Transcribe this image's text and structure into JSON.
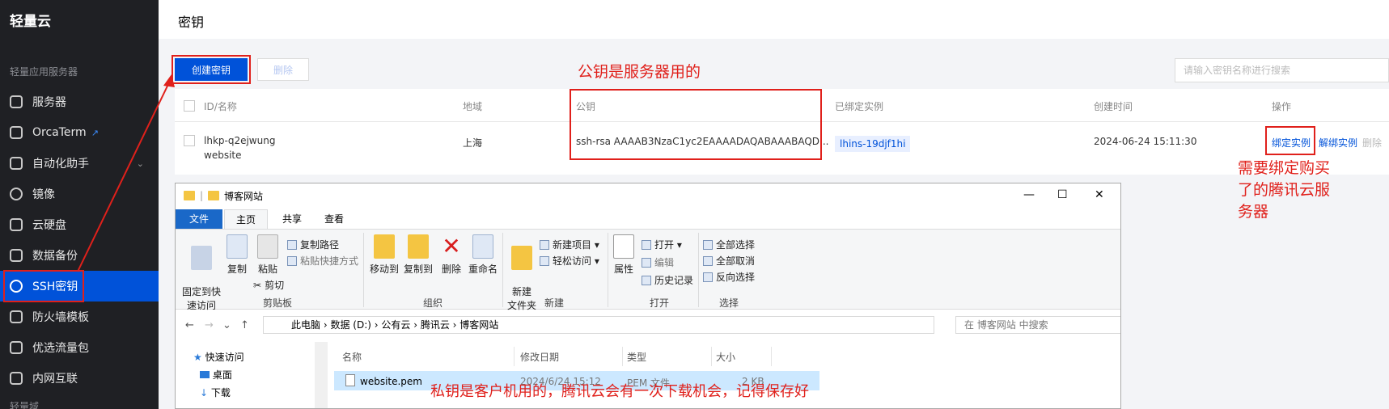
{
  "sidebar": {
    "title": "轻量云",
    "section": "轻量应用服务器",
    "items": [
      {
        "label": "服务器",
        "icon": "box-icon"
      },
      {
        "label": "OrcaTerm",
        "icon": "terminal-icon",
        "ext": "↗"
      },
      {
        "label": "自动化助手",
        "icon": "robot-icon",
        "chevron": "⌄"
      },
      {
        "label": "镜像",
        "icon": "disc-icon"
      },
      {
        "label": "云硬盘",
        "icon": "disk-icon"
      },
      {
        "label": "数据备份",
        "icon": "backup-icon"
      },
      {
        "label": "SSH密钥",
        "icon": "key-icon"
      },
      {
        "label": "防火墙模板",
        "icon": "shield-icon"
      },
      {
        "label": "优选流量包",
        "icon": "package-icon"
      },
      {
        "label": "内网互联",
        "icon": "network-icon"
      }
    ],
    "footer_cut": "轻量域"
  },
  "page": {
    "title": "密钥",
    "create_button": "创建密钥",
    "delete_button": "删除",
    "search_placeholder": "请输入密钥名称进行搜索"
  },
  "table": {
    "headers": [
      "ID/名称",
      "地域",
      "公钥",
      "已绑定实例",
      "创建时间",
      "操作"
    ],
    "row": {
      "id": "lhkp-q2ejwung",
      "name": "website",
      "region": "上海",
      "public_key": "ssh-rsa AAAAB3NzaC1yc2EAAAADAQABAAABAQD...",
      "instance": "lhins-19djf1hi",
      "created": "2024-06-24 15:11:30",
      "actions": [
        "绑定实例",
        "解绑实例",
        "删除"
      ]
    }
  },
  "annotations": {
    "public_key": "公钥是服务器用的",
    "bind": [
      "需要绑定购买",
      "了的腾讯云服",
      "务器"
    ],
    "private_key": "私钥是客户机用的，腾讯云会有一次下载机会，记得保存好"
  },
  "explorer": {
    "title": "博客网站",
    "controls": [
      "—",
      "☐",
      "✕"
    ],
    "tabs": [
      "文件",
      "主页",
      "共享",
      "查看"
    ],
    "ribbon": {
      "clipboard": {
        "pin": "固定到快\n速访问",
        "copy": "复制",
        "paste": "粘贴",
        "copy_path": "复制路径",
        "paste_shortcut": "粘贴快捷方式",
        "cut": "剪切",
        "group": "剪贴板"
      },
      "organize": {
        "move_to": "移动到",
        "copy_to": "复制到",
        "delete": "删除",
        "rename": "重命名",
        "group": "组织"
      },
      "new": {
        "new_folder": "新建\n文件夹",
        "new_item": "新建项目",
        "easy_access": "轻松访问",
        "group": "新建"
      },
      "open": {
        "properties": "属性",
        "open": "打开",
        "edit": "编辑",
        "history": "历史记录",
        "group": "打开"
      },
      "select": {
        "select_all": "全部选择",
        "select_none": "全部取消",
        "invert": "反向选择",
        "group": "选择"
      }
    },
    "breadcrumb": [
      "此电脑",
      "数据 (D:)",
      "公有云",
      "腾讯云",
      "博客网站"
    ],
    "search_placeholder": "在 博客网站 中搜索",
    "nav": {
      "quick_access": "快速访问",
      "desktop": "桌面",
      "downloads": "下载"
    },
    "columns": [
      "名称",
      "修改日期",
      "类型",
      "大小"
    ],
    "file": {
      "name": "website.pem",
      "modified": "2024/6/24 15:12",
      "type": "PEM 文件",
      "size": "2 KB"
    }
  }
}
